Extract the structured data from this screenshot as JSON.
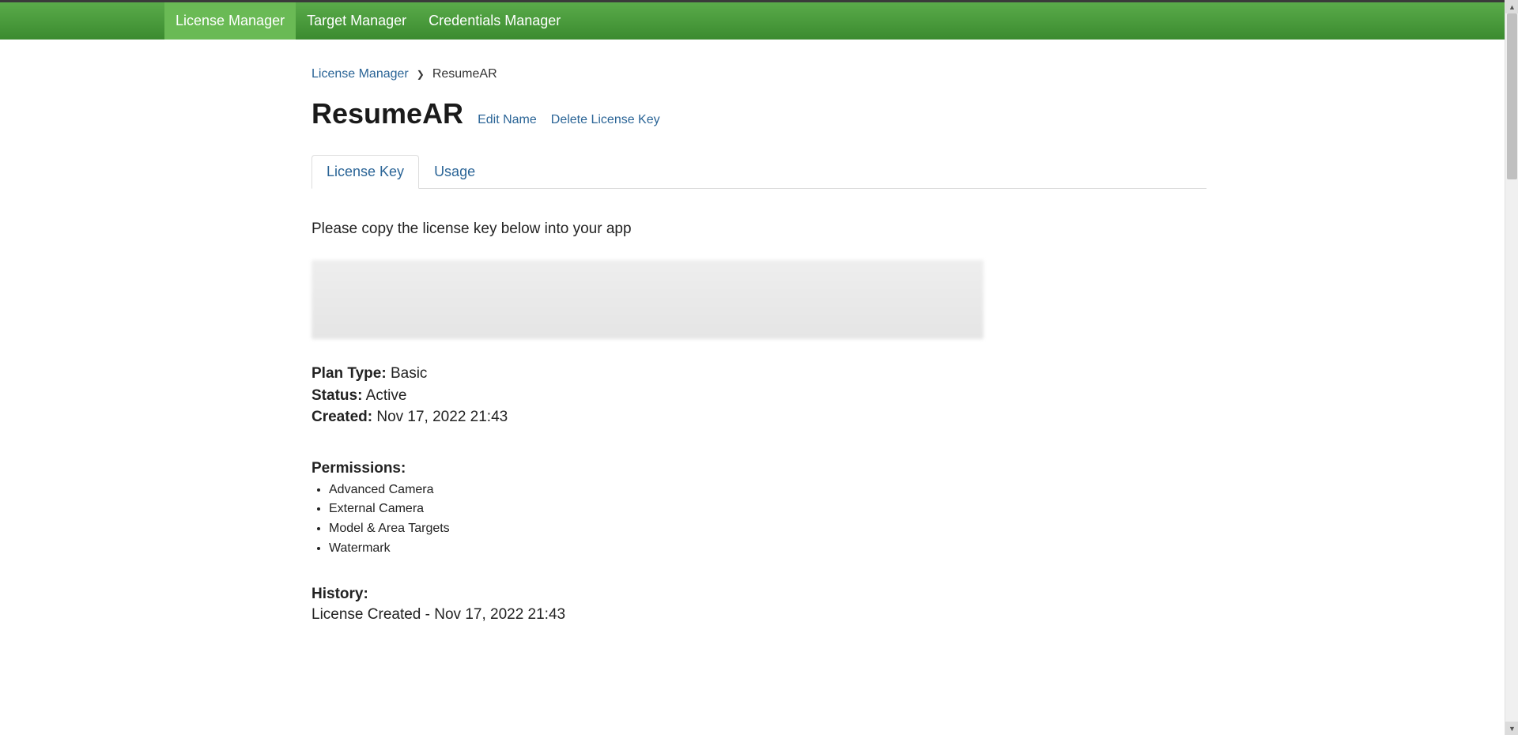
{
  "nav": {
    "items": [
      {
        "label": "License Manager",
        "active": true
      },
      {
        "label": "Target Manager",
        "active": false
      },
      {
        "label": "Credentials Manager",
        "active": false
      }
    ]
  },
  "breadcrumb": {
    "parent": "License Manager",
    "current": "ResumeAR"
  },
  "page_title": "ResumeAR",
  "actions": {
    "edit_name": "Edit Name",
    "delete_key": "Delete License Key"
  },
  "tabs": [
    {
      "label": "License Key",
      "active": true
    },
    {
      "label": "Usage",
      "active": false
    }
  ],
  "instruction": "Please copy the license key below into your app",
  "details": {
    "plan_type_label": "Plan Type:",
    "plan_type_value": "Basic",
    "status_label": "Status:",
    "status_value": "Active",
    "created_label": "Created:",
    "created_value": "Nov 17, 2022 21:43"
  },
  "permissions": {
    "title": "Permissions:",
    "items": [
      "Advanced Camera",
      "External Camera",
      "Model & Area Targets",
      "Watermark"
    ]
  },
  "history": {
    "title": "History:",
    "items": [
      "License Created - Nov 17, 2022 21:43"
    ]
  }
}
